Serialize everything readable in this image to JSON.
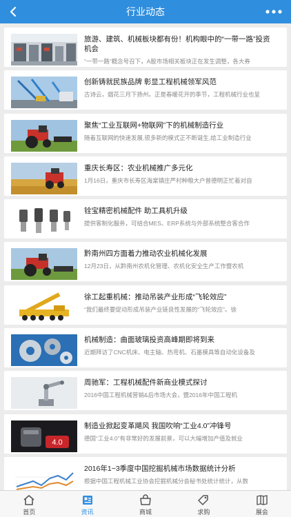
{
  "header": {
    "title": "行业动态"
  },
  "articles": [
    {
      "title": "旅游、建筑、机械板块都有份！机构眼中的“一带一路”投资机会",
      "desc": "“一带一路”概念号召下，A股市场相关板块正在发生调整，各大券"
    },
    {
      "title": "创新铸就民族品牌 彰显工程机械领军风范",
      "desc": "古诗云，烟花三月下扬州。正是春暖花开的季节，工程机械行业也呈"
    },
    {
      "title": "聚焦“工业互联网+物联网”下的机械制造行业",
      "desc": "随着互联网的快速发展,很多新的模式正不断诞生,给工业制造行业"
    },
    {
      "title": "重庆长寿区：农业机械推广多元化",
      "desc": "1月16日，重庆市长寿区海棠镇庄严村种粮大户曾德明正忙着对自"
    },
    {
      "title": "铨宝精密机械配件 助工具机升级",
      "desc": "提供客制化服务，可结合MES、ERP系统与外部系统整合客合作"
    },
    {
      "title": "黔南州四方面着力推动农业机械化发展",
      "desc": "12月23日，从黔南州农机化管理、农机化安全生产工作暨农机"
    },
    {
      "title": "徐工起重机械：推动吊装产业形成“飞轮效应”",
      "desc": "“我们最终要促动形成吊装产业链良性发展的“飞轮效应”。徐"
    },
    {
      "title": "机械制造：曲面玻璃投资高峰期即将到来",
      "desc": "近期拜访了CNC机床、电主轴、热弯机、石墨模具等自动化设备及"
    },
    {
      "title": "周驰军：工程机械配件新商业模式探讨",
      "desc": "2016中国工程机械营销&后市场大会，暨2016年中国工程机"
    },
    {
      "title": "制造业掀起变革飓风 我国吹响“工业4.0”冲锋号",
      "desc": "德国“工业4.0”有非常好的发展前景，可以大幅增加产值及就业"
    },
    {
      "title": "2016年1−3季度中国挖掘机械市场数据统计分析",
      "desc": "根据中国工程机械工业协会挖掘机械分会秘书处统计统计，从数"
    }
  ],
  "thumb_text": {
    "robot": "4.0"
  },
  "tabs": [
    {
      "label": "首页",
      "icon": "home-icon"
    },
    {
      "label": "资讯",
      "icon": "news-icon"
    },
    {
      "label": "商城",
      "icon": "shop-icon"
    },
    {
      "label": "求购",
      "icon": "tag-icon"
    },
    {
      "label": "展会",
      "icon": "book-icon"
    }
  ],
  "active_tab": "资讯",
  "colors": {
    "primary": "#2f8ede",
    "background": "#ececec"
  }
}
